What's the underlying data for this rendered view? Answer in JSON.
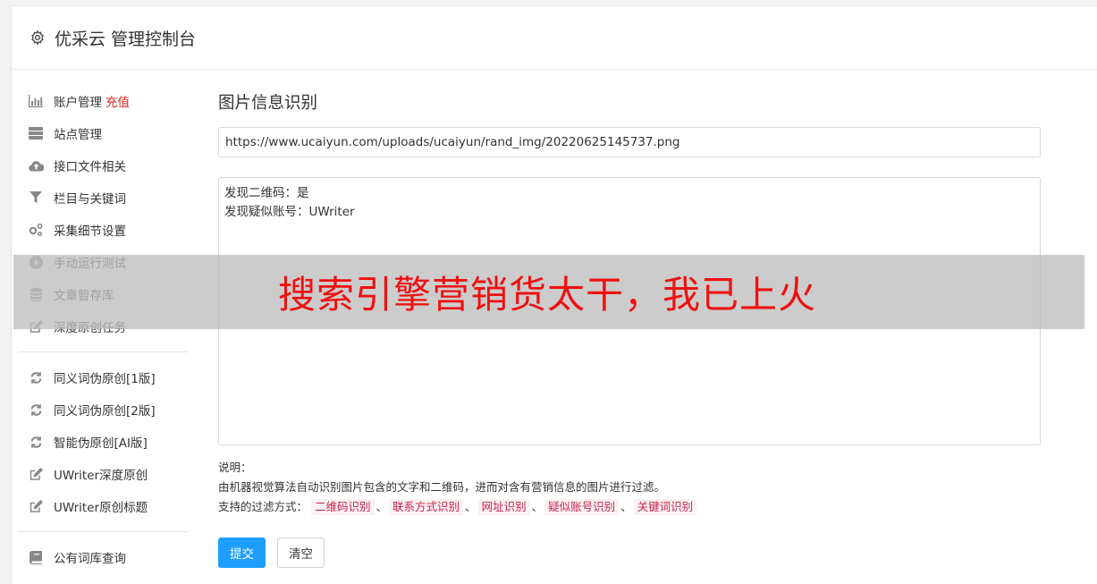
{
  "header": {
    "title": "优采云 管理控制台"
  },
  "sidebar": {
    "groups": [
      [
        {
          "label": "账户管理",
          "badge": "充值",
          "icon": "bar-chart-icon"
        },
        {
          "label": "站点管理",
          "icon": "server-icon"
        },
        {
          "label": "接口文件相关",
          "icon": "cloud-upload-icon"
        },
        {
          "label": "栏目与关键词",
          "icon": "filter-icon"
        },
        {
          "label": "采集细节设置",
          "icon": "gears-icon"
        },
        {
          "label": "手动运行测试",
          "icon": "play-circle-icon"
        },
        {
          "label": "文章暂存库",
          "icon": "database-icon"
        },
        {
          "label": "深度原创任务",
          "icon": "edit-icon"
        }
      ],
      [
        {
          "label": "同义词伪原创[1版]",
          "icon": "refresh-icon"
        },
        {
          "label": "同义词伪原创[2版]",
          "icon": "refresh-icon"
        },
        {
          "label": "智能伪原创[AI版]",
          "icon": "refresh-icon"
        },
        {
          "label": "UWriter深度原创",
          "icon": "edit-icon"
        },
        {
          "label": "UWriter原创标题",
          "icon": "edit-icon"
        }
      ],
      [
        {
          "label": "公有词库查询",
          "icon": "book-icon"
        }
      ]
    ]
  },
  "main": {
    "title": "图片信息识别",
    "url_value": "https://www.ucaiyun.com/uploads/ucaiyun/rand_img/20220625145737.png",
    "result_lines": [
      "发现二维码：是",
      "发现疑似账号：UWriter"
    ],
    "desc_label": "说明：",
    "desc_text": "由机器视觉算法自动识别图片包含的文字和二维码，进而对含有营销信息的图片进行过滤。",
    "filter_label": "支持的过滤方式：",
    "filters": [
      "二维码识别",
      "联系方式识别",
      "网址识别",
      "疑似账号识别",
      "关键词识别"
    ],
    "filter_sep": "、",
    "submit_label": "提交",
    "clear_label": "清空"
  },
  "banner": {
    "text": "搜索引擎营销货太干，我已上火"
  },
  "colors": {
    "accent": "#1e9fff",
    "recharge": "#e02020",
    "banner_text": "#f01010",
    "tag_text": "#c7254e",
    "tag_bg": "#fbf0f2"
  }
}
